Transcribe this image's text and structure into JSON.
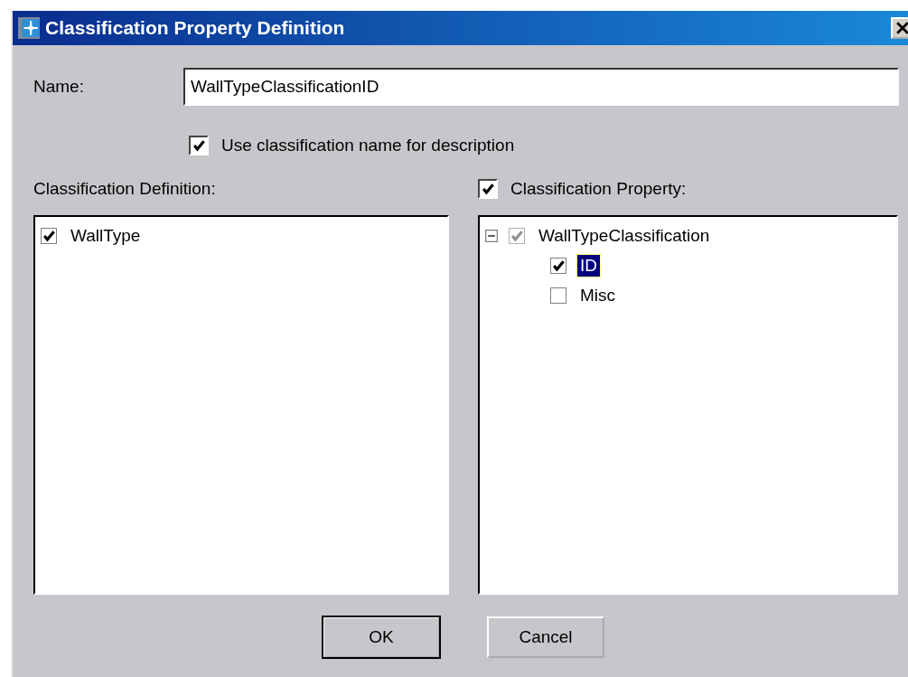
{
  "window": {
    "title": "Classification Property Definition"
  },
  "name_field": {
    "label": "Name:",
    "value": "WallTypeClassificationID"
  },
  "use_name_checkbox": {
    "label": "Use classification name for description",
    "checked": true
  },
  "definition_panel": {
    "label": "Classification Definition:",
    "items": [
      {
        "label": "WallType",
        "checked": true
      }
    ]
  },
  "property_panel": {
    "label": "Classification Property:",
    "checked": true,
    "tree": [
      {
        "label": "WallTypeClassification",
        "expanded": true,
        "checked": true,
        "disabled": true,
        "selected": false,
        "children": [
          {
            "label": "ID",
            "checked": true,
            "disabled": false,
            "selected": true
          },
          {
            "label": "Misc",
            "checked": false,
            "disabled": false,
            "selected": false
          }
        ]
      }
    ]
  },
  "buttons": [
    {
      "label": "OK",
      "default": true
    },
    {
      "label": "Cancel",
      "default": false
    }
  ]
}
